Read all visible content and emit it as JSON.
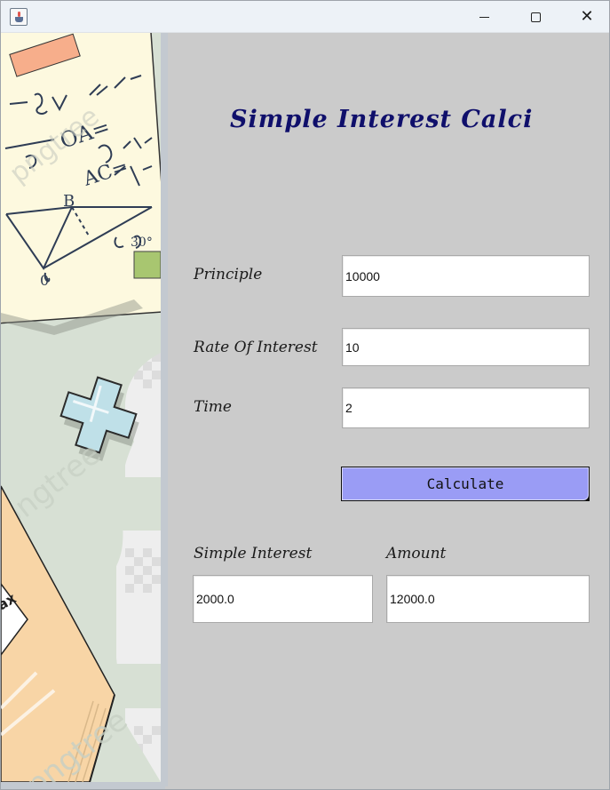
{
  "window": {
    "icon": "java-cup-icon",
    "controls": {
      "minimize": "minimize-icon",
      "maximize": "maximize-icon",
      "close": "✕"
    }
  },
  "app": {
    "title": "Simple Interest Calci",
    "principle": {
      "label": "Principle",
      "value": "10000"
    },
    "rate": {
      "label": "Rate Of Interest",
      "value": "10"
    },
    "time": {
      "label": "Time",
      "value": "2"
    },
    "calculate_label": "Calculate",
    "simple_interest": {
      "label": "Simple Interest",
      "value": "2000.0"
    },
    "amount": {
      "label": "Amount",
      "value": "12000.0"
    }
  },
  "colors": {
    "panel": "#cbcbcb",
    "title": "#0f0f6b",
    "button": "#9a9cf5",
    "titlebar": "#edf2f7"
  }
}
